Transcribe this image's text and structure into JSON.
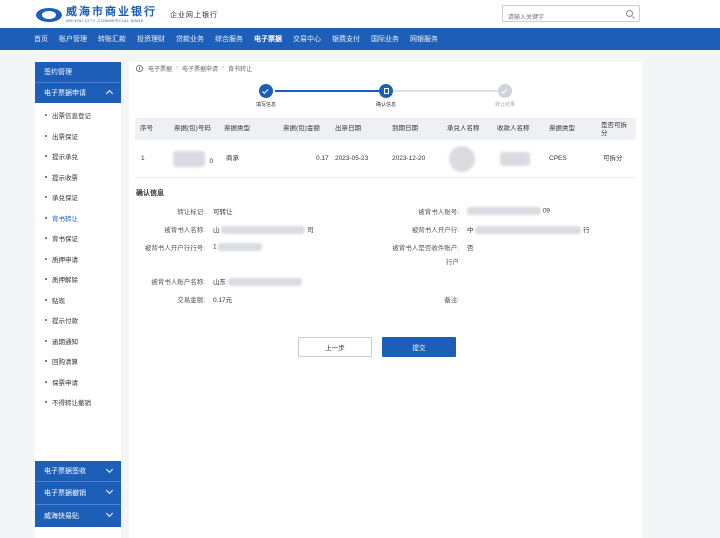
{
  "header": {
    "logo_cn": "威海市商业银行",
    "logo_en": "WEIHAI CITY COMMERCIAL BANK",
    "sub_brand": "企业网上银行",
    "search_placeholder": "请输入关键字"
  },
  "nav": {
    "items": [
      "首页",
      "账户管理",
      "转账汇款",
      "投资理财",
      "贷款业务",
      "综合服务",
      "电子票据",
      "交易中心",
      "银费支付",
      "国际业务",
      "网银服务"
    ],
    "active_index": 6
  },
  "sidebar": {
    "top_item": "签约管理",
    "group_open": "电子票据申请",
    "items": [
      "出票信息登记",
      "出票保证",
      "提示承兑",
      "提示收票",
      "承兑保证",
      "背书转让",
      "背书保证",
      "质押申请",
      "质押解除",
      "贴现",
      "提示付款",
      "逾期通知",
      "回购清算",
      "保票申请",
      "不得转让撤销"
    ],
    "active_index": 5,
    "groups_closed": [
      "电子票据签收",
      "电子票据撤销",
      "威海快易贴"
    ]
  },
  "breadcrumb": [
    "电子票据",
    "电子票据申请",
    "背书转让"
  ],
  "steps": [
    {
      "label": "填写信息",
      "state": "done"
    },
    {
      "label": "确认信息",
      "state": "current"
    },
    {
      "label": "转让结果",
      "state": "todo"
    }
  ],
  "table": {
    "headers": [
      "序号",
      "票据(包)号码",
      "票据类型",
      "票据(包)金额",
      "出票日期",
      "到期日期",
      "承兑人名称",
      "收款人名称",
      "票据类型",
      "是否可拆分"
    ],
    "rows": [
      {
        "no": "1",
        "bill_no_suffix": "0",
        "type": "商承",
        "amount": "0.17",
        "issue_date": "2023-05-23",
        "due_date": "2023-12-20",
        "acceptor": "",
        "payee": "",
        "bill_status": "CPES",
        "splittable": "可拆分"
      }
    ]
  },
  "confirm": {
    "title": "确认信息",
    "transfer_flag_label": "转让标记:",
    "transfer_flag_value": "可转让",
    "endorsee_account_label": "被背书人账号:",
    "endorsee_account_suffix": "09",
    "endorsee_name_label": "被背书人名称:",
    "endorsee_name_prefix": "山",
    "endorsee_name_suffix": "司",
    "endorsee_bank_label": "被背书人开户行:",
    "endorsee_bank_prefix": "中",
    "endorsee_bank_suffix": "行",
    "endorsee_bank_no_label": "被背书人开户行行号:",
    "endorsee_bank_no_prefix": "1",
    "same_bank_label": "被背书人是否收件账户:",
    "same_bank_value": "否",
    "same_bank_tail": "行户",
    "endorser_name_label": "被背书人账户名称:",
    "endorser_name_prefix": "山东",
    "amount_label": "交易金额:",
    "amount_value": "0.17元",
    "remark_label": "备注:"
  },
  "buttons": {
    "prev": "上一步",
    "submit": "提交"
  },
  "colors": {
    "brand": "#1d5fb8",
    "page_bg": "#f4f5f7",
    "table_head_bg": "#eef0f3"
  }
}
